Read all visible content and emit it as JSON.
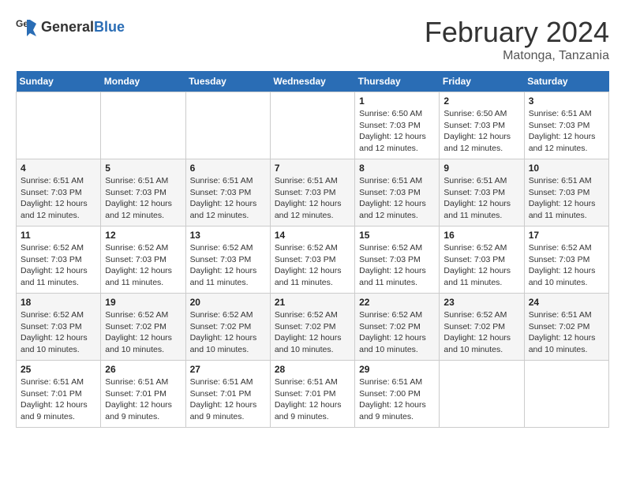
{
  "header": {
    "logo_general": "General",
    "logo_blue": "Blue",
    "month_title": "February 2024",
    "location": "Matonga, Tanzania"
  },
  "weekdays": [
    "Sunday",
    "Monday",
    "Tuesday",
    "Wednesday",
    "Thursday",
    "Friday",
    "Saturday"
  ],
  "weeks": [
    [
      {
        "day": "",
        "info": ""
      },
      {
        "day": "",
        "info": ""
      },
      {
        "day": "",
        "info": ""
      },
      {
        "day": "",
        "info": ""
      },
      {
        "day": "1",
        "info": "Sunrise: 6:50 AM\nSunset: 7:03 PM\nDaylight: 12 hours\nand 12 minutes."
      },
      {
        "day": "2",
        "info": "Sunrise: 6:50 AM\nSunset: 7:03 PM\nDaylight: 12 hours\nand 12 minutes."
      },
      {
        "day": "3",
        "info": "Sunrise: 6:51 AM\nSunset: 7:03 PM\nDaylight: 12 hours\nand 12 minutes."
      }
    ],
    [
      {
        "day": "4",
        "info": "Sunrise: 6:51 AM\nSunset: 7:03 PM\nDaylight: 12 hours\nand 12 minutes."
      },
      {
        "day": "5",
        "info": "Sunrise: 6:51 AM\nSunset: 7:03 PM\nDaylight: 12 hours\nand 12 minutes."
      },
      {
        "day": "6",
        "info": "Sunrise: 6:51 AM\nSunset: 7:03 PM\nDaylight: 12 hours\nand 12 minutes."
      },
      {
        "day": "7",
        "info": "Sunrise: 6:51 AM\nSunset: 7:03 PM\nDaylight: 12 hours\nand 12 minutes."
      },
      {
        "day": "8",
        "info": "Sunrise: 6:51 AM\nSunset: 7:03 PM\nDaylight: 12 hours\nand 12 minutes."
      },
      {
        "day": "9",
        "info": "Sunrise: 6:51 AM\nSunset: 7:03 PM\nDaylight: 12 hours\nand 11 minutes."
      },
      {
        "day": "10",
        "info": "Sunrise: 6:51 AM\nSunset: 7:03 PM\nDaylight: 12 hours\nand 11 minutes."
      }
    ],
    [
      {
        "day": "11",
        "info": "Sunrise: 6:52 AM\nSunset: 7:03 PM\nDaylight: 12 hours\nand 11 minutes."
      },
      {
        "day": "12",
        "info": "Sunrise: 6:52 AM\nSunset: 7:03 PM\nDaylight: 12 hours\nand 11 minutes."
      },
      {
        "day": "13",
        "info": "Sunrise: 6:52 AM\nSunset: 7:03 PM\nDaylight: 12 hours\nand 11 minutes."
      },
      {
        "day": "14",
        "info": "Sunrise: 6:52 AM\nSunset: 7:03 PM\nDaylight: 12 hours\nand 11 minutes."
      },
      {
        "day": "15",
        "info": "Sunrise: 6:52 AM\nSunset: 7:03 PM\nDaylight: 12 hours\nand 11 minutes."
      },
      {
        "day": "16",
        "info": "Sunrise: 6:52 AM\nSunset: 7:03 PM\nDaylight: 12 hours\nand 11 minutes."
      },
      {
        "day": "17",
        "info": "Sunrise: 6:52 AM\nSunset: 7:03 PM\nDaylight: 12 hours\nand 10 minutes."
      }
    ],
    [
      {
        "day": "18",
        "info": "Sunrise: 6:52 AM\nSunset: 7:03 PM\nDaylight: 12 hours\nand 10 minutes."
      },
      {
        "day": "19",
        "info": "Sunrise: 6:52 AM\nSunset: 7:02 PM\nDaylight: 12 hours\nand 10 minutes."
      },
      {
        "day": "20",
        "info": "Sunrise: 6:52 AM\nSunset: 7:02 PM\nDaylight: 12 hours\nand 10 minutes."
      },
      {
        "day": "21",
        "info": "Sunrise: 6:52 AM\nSunset: 7:02 PM\nDaylight: 12 hours\nand 10 minutes."
      },
      {
        "day": "22",
        "info": "Sunrise: 6:52 AM\nSunset: 7:02 PM\nDaylight: 12 hours\nand 10 minutes."
      },
      {
        "day": "23",
        "info": "Sunrise: 6:52 AM\nSunset: 7:02 PM\nDaylight: 12 hours\nand 10 minutes."
      },
      {
        "day": "24",
        "info": "Sunrise: 6:51 AM\nSunset: 7:02 PM\nDaylight: 12 hours\nand 10 minutes."
      }
    ],
    [
      {
        "day": "25",
        "info": "Sunrise: 6:51 AM\nSunset: 7:01 PM\nDaylight: 12 hours\nand 9 minutes."
      },
      {
        "day": "26",
        "info": "Sunrise: 6:51 AM\nSunset: 7:01 PM\nDaylight: 12 hours\nand 9 minutes."
      },
      {
        "day": "27",
        "info": "Sunrise: 6:51 AM\nSunset: 7:01 PM\nDaylight: 12 hours\nand 9 minutes."
      },
      {
        "day": "28",
        "info": "Sunrise: 6:51 AM\nSunset: 7:01 PM\nDaylight: 12 hours\nand 9 minutes."
      },
      {
        "day": "29",
        "info": "Sunrise: 6:51 AM\nSunset: 7:00 PM\nDaylight: 12 hours\nand 9 minutes."
      },
      {
        "day": "",
        "info": ""
      },
      {
        "day": "",
        "info": ""
      }
    ]
  ]
}
